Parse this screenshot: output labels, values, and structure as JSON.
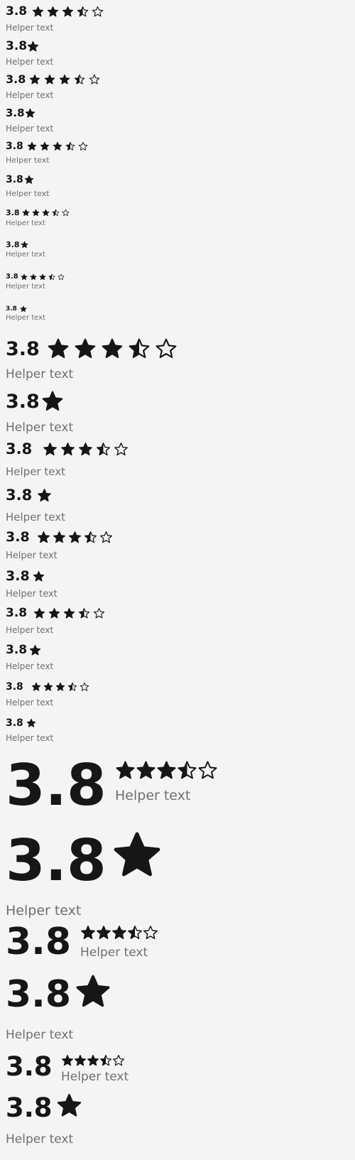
{
  "ratings": [
    {
      "value": "3.8",
      "helper": "Helper text",
      "display": "full",
      "score": 3.5
    },
    {
      "value": "3.8",
      "helper": "Helper text",
      "display": "single",
      "score": 1
    },
    {
      "value": "3.8",
      "helper": "Helper text",
      "display": "full",
      "score": 3.5
    },
    {
      "value": "3.8",
      "helper": "Helper text",
      "display": "single",
      "score": 1
    },
    {
      "value": "3.8",
      "helper": "Helper text",
      "display": "full",
      "score": 3.5
    },
    {
      "value": "3.8",
      "helper": "Helper text",
      "display": "single",
      "score": 1
    },
    {
      "value": "3.8",
      "helper": "Helper text",
      "display": "full",
      "score": 3.5
    },
    {
      "value": "3.8",
      "helper": "Helper text",
      "display": "single",
      "score": 1
    },
    {
      "value": "3.8",
      "helper": "Helper text",
      "display": "full",
      "score": 3.5
    },
    {
      "value": "3.8",
      "helper": "Helper text",
      "display": "single",
      "score": 1
    },
    {
      "value": "3.8",
      "helper": "Helper text",
      "display": "full",
      "score": 3.5
    },
    {
      "value": "3.8",
      "helper": "Helper text",
      "display": "single",
      "score": 1
    },
    {
      "value": "3.8",
      "helper": "Helper text",
      "display": "full",
      "score": 3.5
    },
    {
      "value": "3.8",
      "helper": "Helper text",
      "display": "single",
      "score": 1
    },
    {
      "value": "3.8",
      "helper": "Helper text",
      "display": "full",
      "score": 3.5
    },
    {
      "value": "3.8",
      "helper": "Helper text",
      "display": "single",
      "score": 1
    },
    {
      "value": "3.8",
      "helper": "Helper text",
      "display": "full",
      "score": 3.5
    },
    {
      "value": "3.8",
      "helper": "Helper text",
      "display": "single",
      "score": 1
    },
    {
      "value": "3.8",
      "helper": "Helper text",
      "display": "full",
      "score": 3.5
    },
    {
      "value": "3.8",
      "helper": "Helper text",
      "display": "single",
      "score": 1
    },
    {
      "value": "3.8",
      "helper": "Helper text",
      "display": "full",
      "score": 3.5
    },
    {
      "value": "3.8",
      "helper": "Helper text",
      "display": "single",
      "score": 1
    },
    {
      "value": "3.8",
      "helper": "Helper text",
      "display": "full",
      "score": 3.5
    },
    {
      "value": "3.8",
      "helper": "Helper text",
      "display": "single",
      "score": 1
    },
    {
      "value": "3.8",
      "helper": "Helper text",
      "display": "full",
      "score": 3.5
    },
    {
      "value": "3.8",
      "helper": "Helper text",
      "display": "single",
      "score": 1
    }
  ],
  "colors": {
    "star_fill": "#161616",
    "text": "#161616",
    "helper": "#6f6f6f",
    "background": "#f4f4f4"
  }
}
